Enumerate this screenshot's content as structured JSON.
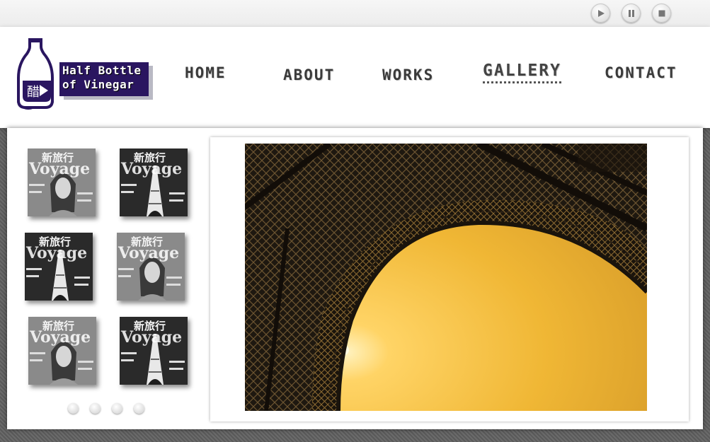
{
  "logo": {
    "line1": "Half Bottle",
    "line2": "of Vinegar",
    "seal_char": "醋"
  },
  "media_controls": [
    {
      "icon": "play-icon"
    },
    {
      "icon": "pause-icon"
    },
    {
      "icon": "stop-icon"
    }
  ],
  "nav": {
    "home": "HOME",
    "about": "ABOUT",
    "works": "WORKS",
    "gallery": "GALLERY",
    "contact": "CONTACT",
    "active": "gallery"
  },
  "thumbnails": {
    "cover_title_cn": "新旅行",
    "cover_title_en": "Voyage",
    "items": [
      {
        "variant": "model"
      },
      {
        "variant": "tower"
      },
      {
        "variant": "tower"
      },
      {
        "variant": "model"
      },
      {
        "variant": "model"
      },
      {
        "variant": "tower"
      }
    ]
  },
  "pagination_dots": 4,
  "main_photo": {
    "subject": "eiffel-tower-arch-at-sunset"
  }
}
